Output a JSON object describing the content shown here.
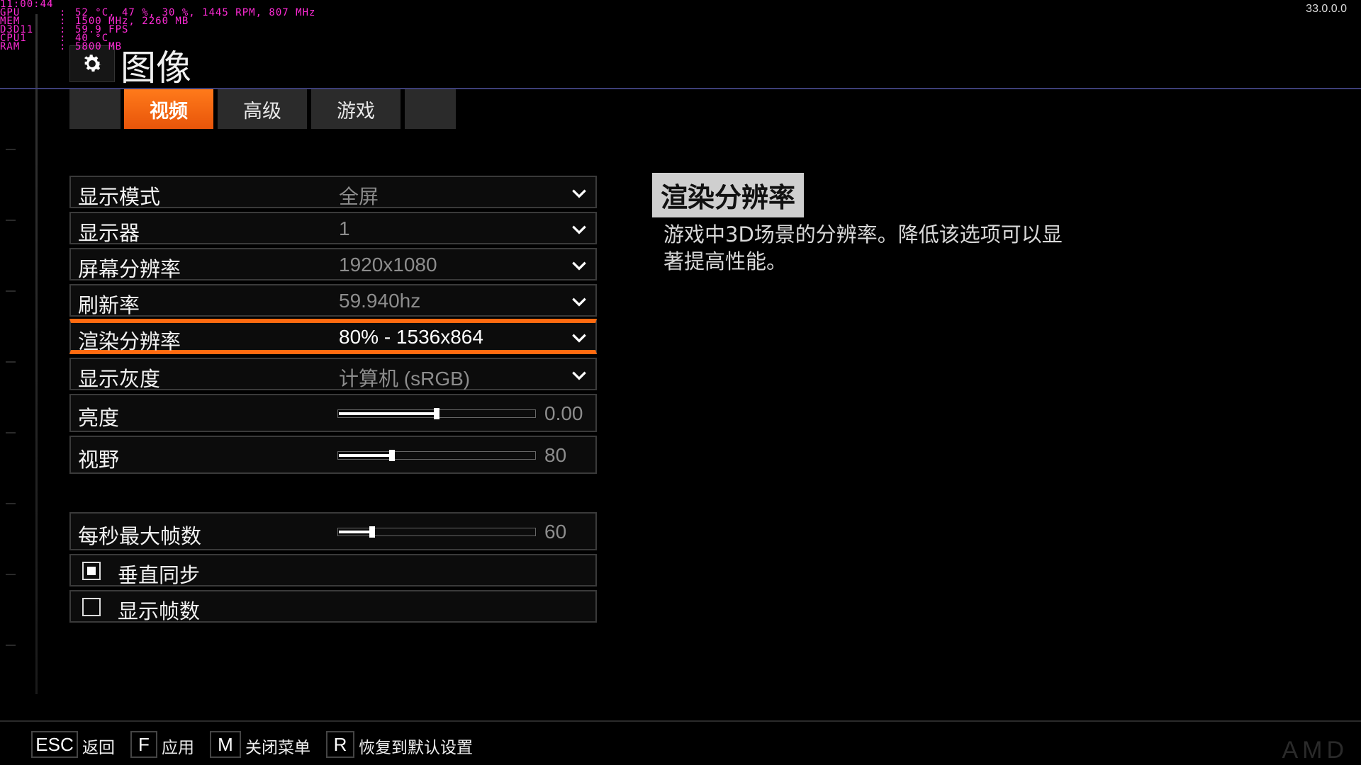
{
  "osd": {
    "clock": "11:00:44",
    "rows": [
      {
        "key": "GPU",
        "val": "52 °C, 47 %, 30 %, 1445 RPM, 807 MHz"
      },
      {
        "key": "MEM",
        "val": "1500 MHz, 2260 MB"
      },
      {
        "key": "D3D11",
        "val": "59.9 FPS"
      },
      {
        "key": "CPU1",
        "val": "40 °C"
      },
      {
        "key": "RAM",
        "val": "5800 MB"
      }
    ],
    "sep": ":"
  },
  "version": "33.0.0.0",
  "header": {
    "title": "图像",
    "icon": "gear-icon"
  },
  "tabs": [
    {
      "label": ""
    },
    {
      "label": "视频",
      "active": true
    },
    {
      "label": "高级"
    },
    {
      "label": "游戏"
    },
    {
      "label": ""
    }
  ],
  "settings": {
    "display_mode": {
      "label": "显示模式",
      "value": "全屏"
    },
    "monitor": {
      "label": "显示器",
      "value": "1"
    },
    "screen_resolution": {
      "label": "屏幕分辨率",
      "value": "1920x1080"
    },
    "refresh_rate": {
      "label": "刷新率",
      "value": "59.940hz"
    },
    "render_resolution": {
      "label": "渲染分辨率",
      "value": "80% - 1536x864"
    },
    "display_gamma": {
      "label": "显示灰度",
      "value": "计算机 (sRGB)"
    },
    "brightness": {
      "label": "亮度",
      "value": "0.00",
      "level": 0.5
    },
    "fov": {
      "label": "视野",
      "value": "80",
      "level": 0.27
    },
    "max_fps": {
      "label": "每秒最大帧数",
      "value": "60",
      "level": 0.17
    },
    "vsync": {
      "label": "垂直同步",
      "checked": true
    },
    "show_fps": {
      "label": "显示帧数",
      "checked": false
    }
  },
  "description": {
    "title": "渲染分辨率",
    "text": "游戏中3D场景的分辨率。降低该选项可以显著提高性能。"
  },
  "footer": {
    "keys": [
      {
        "key": "ESC",
        "label": "返回"
      },
      {
        "key": "F",
        "label": "应用"
      },
      {
        "key": "M",
        "label": "关闭菜单"
      },
      {
        "key": "R",
        "label": "恢复到默认设置"
      }
    ],
    "logo": "AMD"
  },
  "colors": {
    "accent": "#ff6a10",
    "osd": "#ff2bd6",
    "header_line": "#3d3f78"
  }
}
